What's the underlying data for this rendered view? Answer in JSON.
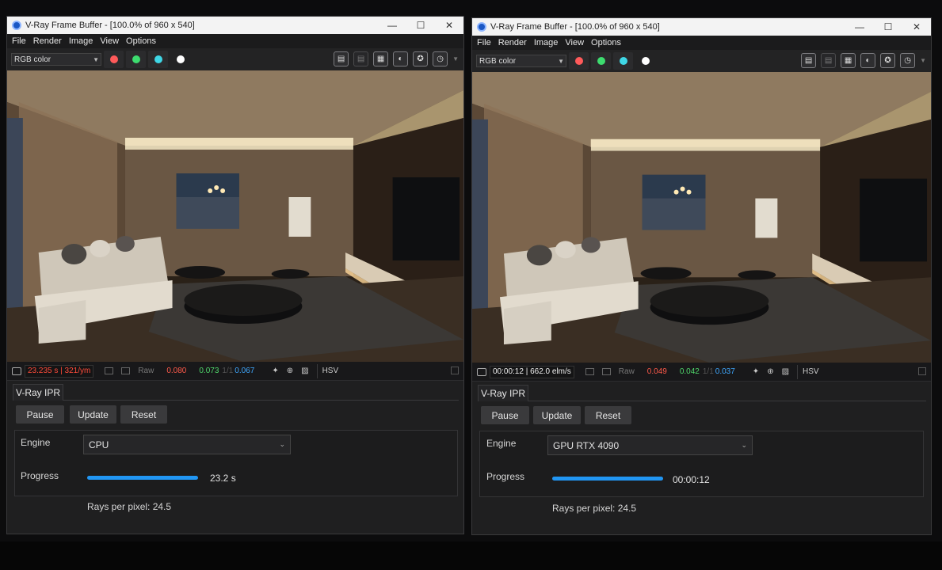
{
  "colors": {
    "red_channel": "#ff5a5a",
    "green_channel": "#3ddc6f",
    "blue_channel": "#3fd7e6",
    "alpha_channel": "#ffffff",
    "progress": "#2196f3"
  },
  "windows": [
    {
      "title": "V-Ray Frame Buffer - [100.0% of 960 x 540]",
      "menu": [
        "File",
        "Render",
        "Image",
        "View",
        "Options"
      ],
      "channel": "RGB color",
      "toolbar_icons": [
        "save-image-icon",
        "clear-image-icon",
        "history-icon",
        "compare-icon",
        "lens-effects-icon",
        "stamp-icon"
      ],
      "status": {
        "time": "23.235 s | 321/ym",
        "raw_label": "Raw",
        "r": "0.080",
        "g": "0.073",
        "separator": "1/1",
        "b": "0.067",
        "color_mode": "HSV"
      },
      "ipr": {
        "tab": "V-Ray IPR",
        "buttons": {
          "pause": "Pause",
          "update": "Update",
          "reset": "Reset"
        },
        "engine_label": "Engine",
        "engine_value": "CPU",
        "progress_label": "Progress",
        "progress_fraction": 1.0,
        "progress_text": "23.2 s",
        "rays": "Rays per pixel: 24.5"
      }
    },
    {
      "title": "V-Ray Frame Buffer - [100.0% of 960 x 540]",
      "menu": [
        "File",
        "Render",
        "Image",
        "View",
        "Options"
      ],
      "channel": "RGB color",
      "toolbar_icons": [
        "save-image-icon",
        "clear-image-icon",
        "history-icon",
        "compare-icon",
        "lens-effects-icon",
        "stamp-icon"
      ],
      "status": {
        "time": "00:00:12 | 662.0 elm/s",
        "raw_label": "Raw",
        "r": "0.049",
        "g": "0.042",
        "separator": "1/1",
        "b": "0.037",
        "color_mode": "HSV"
      },
      "ipr": {
        "tab": "V-Ray IPR",
        "buttons": {
          "pause": "Pause",
          "update": "Update",
          "reset": "Reset"
        },
        "engine_label": "Engine",
        "engine_value": "GPU RTX 4090",
        "progress_label": "Progress",
        "progress_fraction": 1.0,
        "progress_text": "00:00:12",
        "rays": "Rays per pixel: 24.5"
      }
    }
  ]
}
